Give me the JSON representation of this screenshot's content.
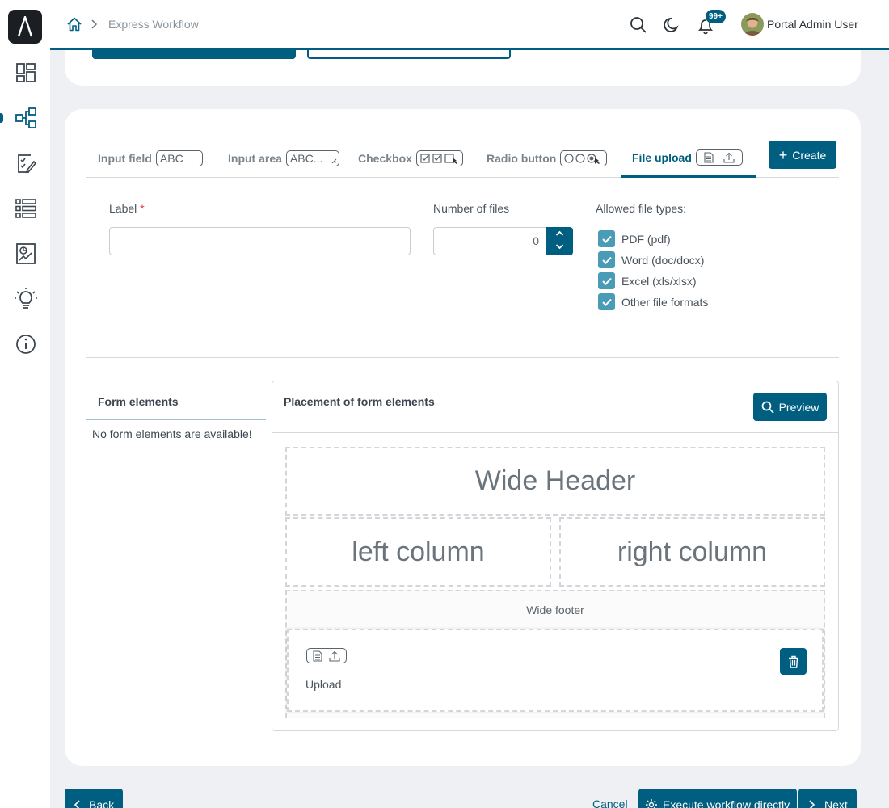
{
  "header": {
    "breadcrumb": "Express Workflow",
    "notification_count": "99+",
    "user_name": "Portal Admin User"
  },
  "tabs": [
    {
      "label": "Input field",
      "glyph": "ABC",
      "icon": "input-field-icon"
    },
    {
      "label": "Input area",
      "glyph": "ABC...",
      "icon": "input-area-icon"
    },
    {
      "label": "Checkbox",
      "icon": "checkbox-icon"
    },
    {
      "label": "Radio button",
      "icon": "radio-button-icon"
    },
    {
      "label": "File upload",
      "icon": "file-upload-icon",
      "active": true
    }
  ],
  "create_label": "Create",
  "form": {
    "label_label": "Label",
    "required_mark": "*",
    "label_value": "",
    "files_label": "Number of files",
    "files_value": "0",
    "types_label": "Allowed file types:",
    "types": [
      "PDF (pdf)",
      "Word (doc/docx)",
      "Excel (xls/xlsx)",
      "Other file formats"
    ]
  },
  "form_elements": {
    "title": "Form elements",
    "empty": "No form elements are available!"
  },
  "placement": {
    "title": "Placement of form elements",
    "preview_label": "Preview",
    "wide_header": "Wide Header",
    "left_column": "left column",
    "right_column": "right column",
    "wide_footer": "Wide footer",
    "upload_label": "Upload"
  },
  "actions": {
    "back": "Back",
    "cancel": "Cancel",
    "execute": "Execute workflow directly",
    "next": "Next"
  },
  "colors": {
    "primary": "#005e80",
    "checkbox": "#4a9bb5"
  }
}
